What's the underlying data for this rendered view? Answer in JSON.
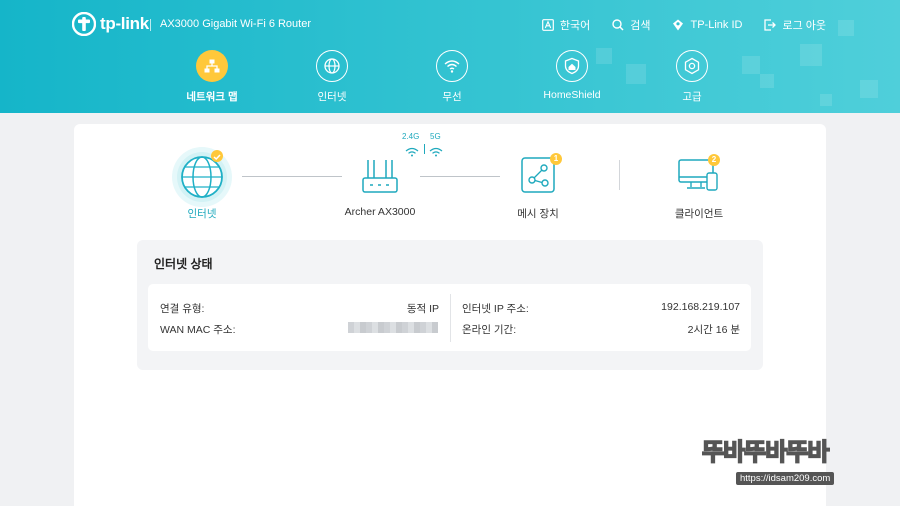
{
  "header": {
    "brand": "tp-link",
    "model": "AX3000 Gigabit Wi-Fi 6 Router",
    "links": [
      {
        "label": "한국어",
        "icon": "language-icon"
      },
      {
        "label": "검색",
        "icon": "search-icon"
      },
      {
        "label": "TP-Link ID",
        "icon": "tplink-id-icon"
      },
      {
        "label": "로그 아웃",
        "icon": "logout-icon"
      }
    ],
    "colors": {
      "primary": "#1fbbcd",
      "accent": "#ffc83a"
    }
  },
  "nav": {
    "items": [
      {
        "label": "네트워크 맵",
        "icon": "network-map-icon",
        "active": true
      },
      {
        "label": "인터넷",
        "icon": "globe-icon",
        "active": false
      },
      {
        "label": "무선",
        "icon": "wifi-icon",
        "active": false
      },
      {
        "label": "HomeShield",
        "icon": "homeshield-icon",
        "active": false
      },
      {
        "label": "고급",
        "icon": "gear-icon",
        "active": false
      }
    ]
  },
  "topology": {
    "internet_label": "인터넷",
    "router_label": "Archer AX3000",
    "band_24": "2.4G",
    "band_5": "5G",
    "mesh_label": "메시 장치",
    "mesh_count": "1",
    "clients_label": "클라이언트",
    "clients_count": "2"
  },
  "internet_status": {
    "title": "인터넷 상태",
    "connection_type_label": "연결 유형:",
    "connection_type_value": "동적 IP",
    "wan_mac_label": "WAN MAC 주소:",
    "internet_ip_label": "인터넷 IP 주소:",
    "internet_ip_value": "192.168.219.107",
    "online_time_label": "온라인 기간:",
    "online_time_value": "2시간 16 분"
  },
  "watermark": {
    "text": "뚜바뚜바뚜바",
    "url": "https://idsam209.com"
  }
}
